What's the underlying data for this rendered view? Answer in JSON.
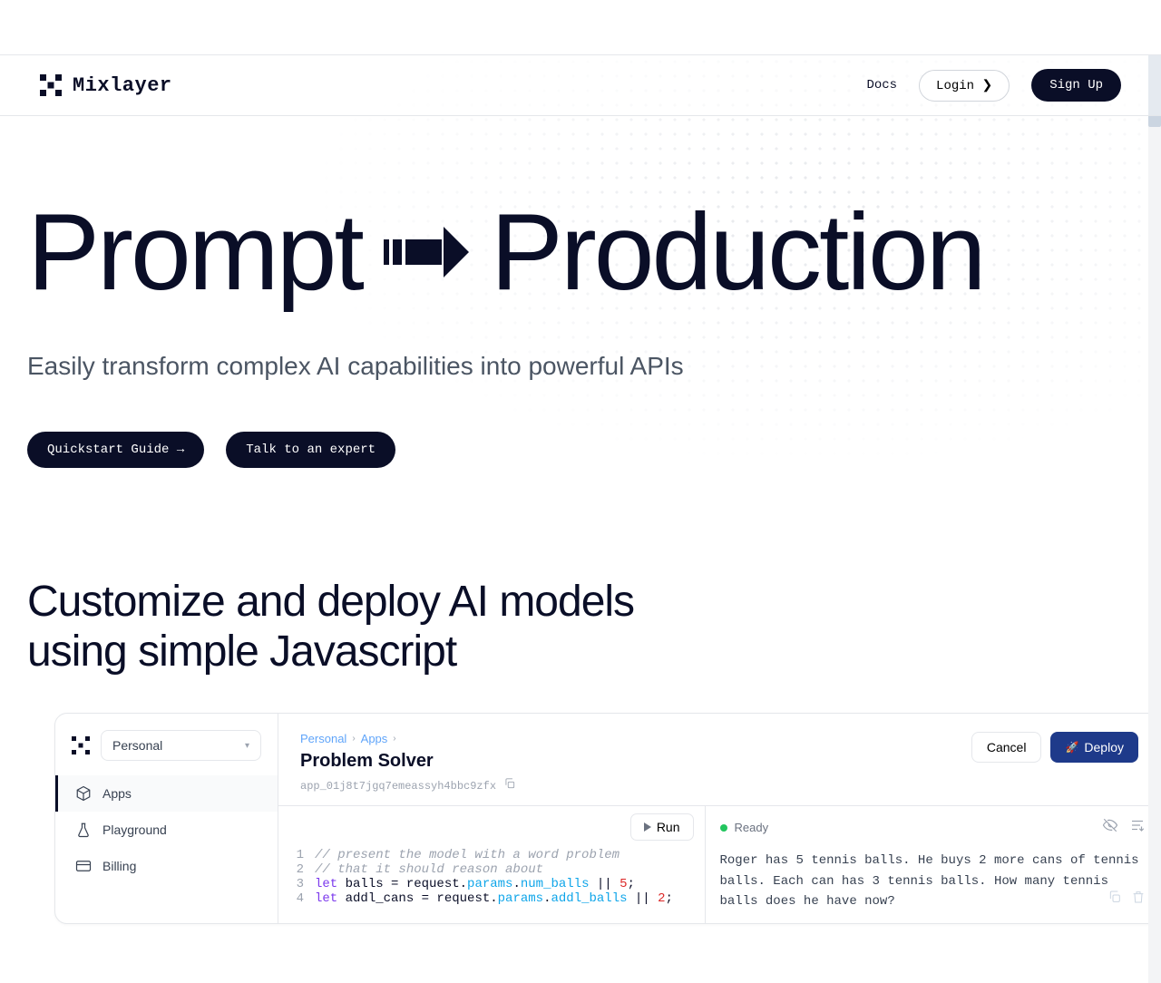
{
  "nav": {
    "brand": "Mixlayer",
    "docs_label": "Docs",
    "login_label": "Login ❯",
    "signup_label": "Sign Up"
  },
  "hero": {
    "title_left": "Prompt",
    "title_right": "Production",
    "subtitle": "Easily transform complex AI capabilities into powerful APIs",
    "quickstart_label": "Quickstart Guide →",
    "talk_expert_label": "Talk to an expert"
  },
  "section": {
    "heading_line1": "Customize and deploy AI models",
    "heading_line2": "using simple Javascript"
  },
  "console": {
    "workspace": "Personal",
    "sidebar": {
      "items": [
        {
          "label": "Apps",
          "icon": "cube"
        },
        {
          "label": "Playground",
          "icon": "flask"
        },
        {
          "label": "Billing",
          "icon": "card"
        }
      ]
    },
    "breadcrumb": {
      "root": "Personal",
      "section": "Apps"
    },
    "app_title": "Problem Solver",
    "app_id": "app_01j8t7jgq7emeassyh4bbc9zfx",
    "cancel_label": "Cancel",
    "deploy_label": "Deploy",
    "run_label": "Run",
    "status_label": "Ready",
    "code": {
      "lines": [
        {
          "n": "1",
          "html": "<span class='tok-comment'>// present the model with a word problem</span>"
        },
        {
          "n": "2",
          "html": "<span class='tok-comment'>// that it should reason about</span>"
        },
        {
          "n": "3",
          "html": "<span class='tok-keyword'>let</span> balls = request.<span class='tok-prop'>params</span>.<span class='tok-prop'>num_balls</span> || <span class='tok-num'>5</span>;"
        },
        {
          "n": "4",
          "html": "<span class='tok-keyword'>let</span> addl_cans = request.<span class='tok-prop'>params</span>.<span class='tok-prop'>addl_balls</span> || <span class='tok-num'>2</span>;"
        }
      ]
    },
    "output_text": "Roger has 5 tennis balls. He buys 2 more cans of tennis balls. Each can has 3 tennis balls. How many tennis balls does he have now?"
  }
}
